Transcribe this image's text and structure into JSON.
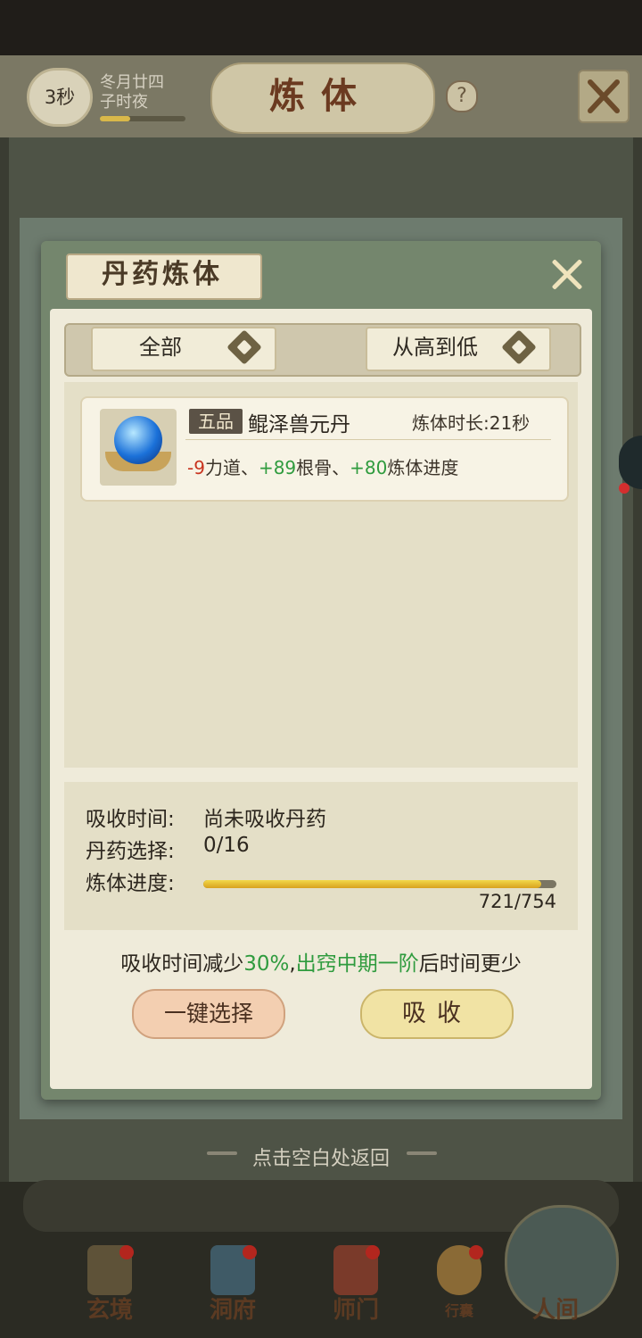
{
  "header": {
    "timer": "3秒",
    "date_line1": "冬月廿四",
    "date_line2": "子时夜",
    "title": "炼体",
    "help": "?"
  },
  "dialog": {
    "title": "丹药炼体",
    "filter_category": "全部",
    "filter_sort": "从高到低",
    "items": [
      {
        "grade": "五品",
        "name": "鲲泽兽元丹",
        "duration": "炼体时长:21秒",
        "effect_1_value": "-9",
        "effect_1_label": "力道、",
        "effect_2_value": "+89",
        "effect_2_label": "根骨、",
        "effect_3_value": "+80",
        "effect_3_label": "炼体进度"
      }
    ],
    "info": {
      "absorb_time_label": "吸收时间:",
      "absorb_time_value": "尚未吸收丹药",
      "pill_select_label": "丹药选择:",
      "pill_select_value": "0/16",
      "progress_label": "炼体进度:",
      "progress_current": 721,
      "progress_max": 754,
      "progress_text": "721/754"
    },
    "note_part1": "吸收时间减少",
    "note_percent": "30%",
    "note_part2": ",",
    "note_stage": "出窍中期一阶",
    "note_part3": "后时间更少",
    "btn_select": "一键选择",
    "btn_absorb": "吸收"
  },
  "hint": "点击空白处返回",
  "nav": {
    "items": [
      {
        "label": "玄境"
      },
      {
        "label": "洞府"
      },
      {
        "label": "师门"
      },
      {
        "label": "行囊"
      },
      {
        "label": "人间"
      }
    ]
  },
  "colors": {
    "negative": "#c8331e",
    "positive": "#2f9b3e",
    "progress": "#e8c235"
  }
}
